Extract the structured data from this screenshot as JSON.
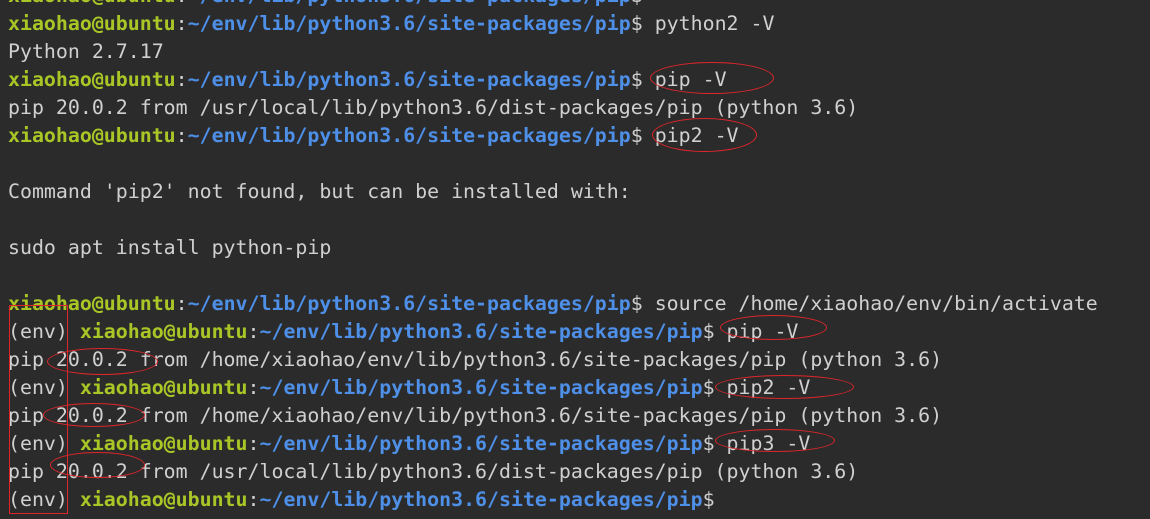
{
  "prompt": {
    "user": "xiaohao@ubuntu",
    "colon": ":",
    "path": "~/env/lib/python3.6/site-packages/pip",
    "dollar": "$ ",
    "env": "(env) "
  },
  "colors": {
    "background": "#2b2b2b",
    "user": "#a8c626",
    "path": "#4e8fe8",
    "text": "#d0d0d0",
    "annotation": "#e0262a"
  },
  "lines": [
    {
      "type": "prompt",
      "env": false,
      "cmd": ""
    },
    {
      "type": "prompt",
      "env": false,
      "cmd": "python2 -V"
    },
    {
      "type": "output",
      "text": "Python 2.7.17"
    },
    {
      "type": "prompt",
      "env": false,
      "cmd": "pip -V"
    },
    {
      "type": "output",
      "text": "pip 20.0.2 from /usr/local/lib/python3.6/dist-packages/pip (python 3.6)"
    },
    {
      "type": "prompt",
      "env": false,
      "cmd": "pip2 -V"
    },
    {
      "type": "output",
      "text": ""
    },
    {
      "type": "output",
      "text": "Command 'pip2' not found, but can be installed with:"
    },
    {
      "type": "output",
      "text": ""
    },
    {
      "type": "output",
      "text": "sudo apt install python-pip"
    },
    {
      "type": "output",
      "text": ""
    },
    {
      "type": "prompt",
      "env": false,
      "cmd": "source /home/xiaohao/env/bin/activate"
    },
    {
      "type": "prompt",
      "env": true,
      "cmd": "pip -V"
    },
    {
      "type": "output",
      "text": "pip 20.0.2 from /home/xiaohao/env/lib/python3.6/site-packages/pip (python 3.6)"
    },
    {
      "type": "prompt",
      "env": true,
      "cmd": "pip2 -V"
    },
    {
      "type": "output",
      "text": "pip 20.0.2 from /home/xiaohao/env/lib/python3.6/site-packages/pip (python 3.6)"
    },
    {
      "type": "prompt",
      "env": true,
      "cmd": "pip3 -V"
    },
    {
      "type": "output",
      "text": "pip 20.0.2 from /usr/local/lib/python3.6/dist-packages/pip (python 3.6)"
    },
    {
      "type": "prompt",
      "env": true,
      "cmd": ""
    }
  ]
}
